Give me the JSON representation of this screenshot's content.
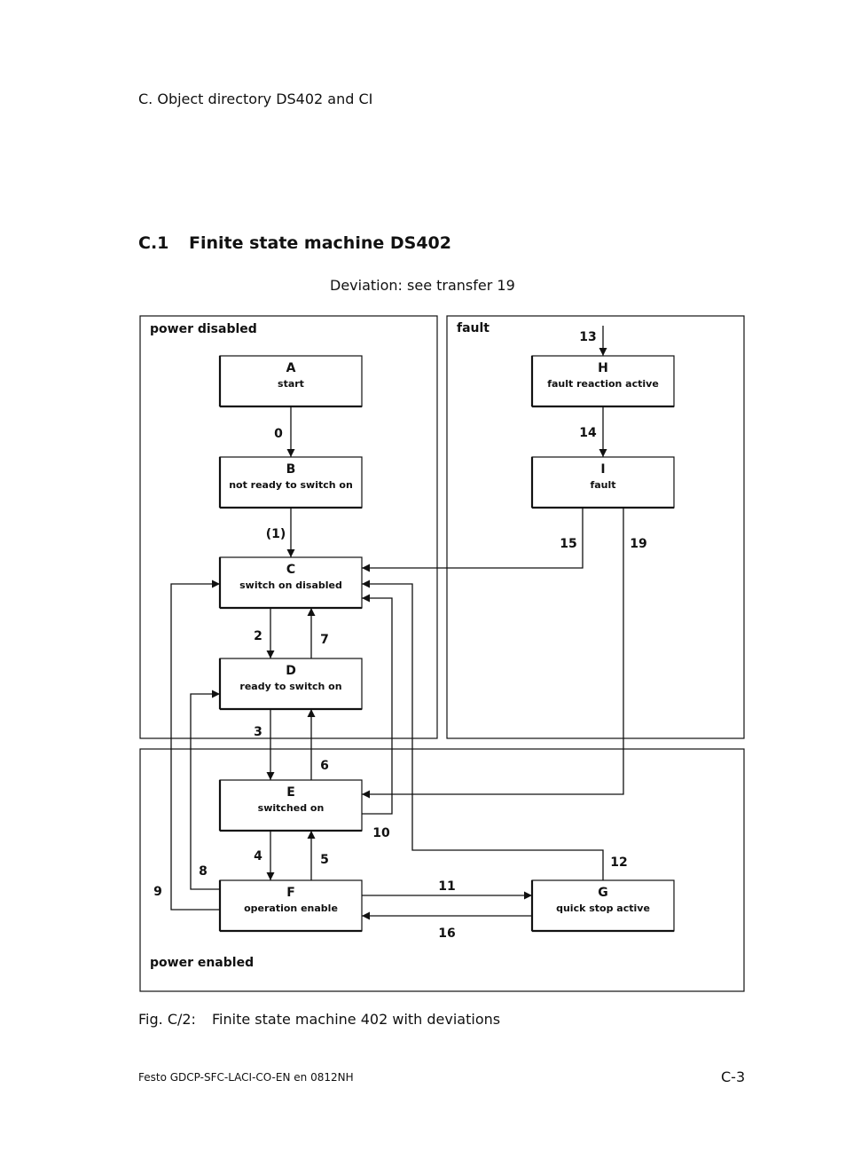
{
  "page": {
    "header": "C.   Object directory DS402 and CI",
    "section_number": "C.1",
    "section_title": "Finite state machine DS402",
    "deviation_note": "Deviation: see transfer 19",
    "caption_label": "Fig. C/2:",
    "caption_text": "Finite state machine 402 with deviations",
    "footer_left": "Festo  GDCP-SFC-LACI-CO-EN  en 0812NH",
    "footer_right": "C-3"
  },
  "diagram": {
    "regions": [
      {
        "id": "power_disabled",
        "label": "power disabled"
      },
      {
        "id": "fault",
        "label": "fault"
      },
      {
        "id": "power_enabled",
        "label": "power enabled"
      }
    ],
    "states": [
      {
        "id": "A",
        "letter": "A",
        "name": "start",
        "region": "power_disabled"
      },
      {
        "id": "B",
        "letter": "B",
        "name": "not ready to switch on",
        "region": "power_disabled"
      },
      {
        "id": "C",
        "letter": "C",
        "name": "switch on disabled",
        "region": "power_disabled"
      },
      {
        "id": "D",
        "letter": "D",
        "name": "ready to switch on",
        "region": "power_disabled"
      },
      {
        "id": "E",
        "letter": "E",
        "name": "switched on",
        "region": "power_enabled"
      },
      {
        "id": "F",
        "letter": "F",
        "name": "operation enable",
        "region": "power_enabled"
      },
      {
        "id": "G",
        "letter": "G",
        "name": "quick stop active",
        "region": "power_enabled"
      },
      {
        "id": "H",
        "letter": "H",
        "name": "fault reaction active",
        "region": "fault"
      },
      {
        "id": "I",
        "letter": "I",
        "name": "fault",
        "region": "fault"
      }
    ],
    "transitions": [
      {
        "label": "0",
        "from": "A",
        "to": "B"
      },
      {
        "label": "(1)",
        "from": "B",
        "to": "C"
      },
      {
        "label": "2",
        "from": "C",
        "to": "D"
      },
      {
        "label": "3",
        "from": "D",
        "to": "E"
      },
      {
        "label": "4",
        "from": "E",
        "to": "F"
      },
      {
        "label": "5",
        "from": "F",
        "to": "E"
      },
      {
        "label": "6",
        "from": "E",
        "to": "D"
      },
      {
        "label": "7",
        "from": "D",
        "to": "C"
      },
      {
        "label": "8",
        "from": "F",
        "to": "D"
      },
      {
        "label": "9",
        "from": "F",
        "to": "C"
      },
      {
        "label": "10",
        "from": "E",
        "to": "C"
      },
      {
        "label": "11",
        "from": "F",
        "to": "G"
      },
      {
        "label": "12",
        "from": "G",
        "to": "C"
      },
      {
        "label": "13",
        "from": "",
        "to": "H"
      },
      {
        "label": "14",
        "from": "H",
        "to": "I"
      },
      {
        "label": "15",
        "from": "I",
        "to": "C"
      },
      {
        "label": "16",
        "from": "G",
        "to": "F"
      },
      {
        "label": "19",
        "from": "I",
        "to": "E"
      }
    ]
  }
}
